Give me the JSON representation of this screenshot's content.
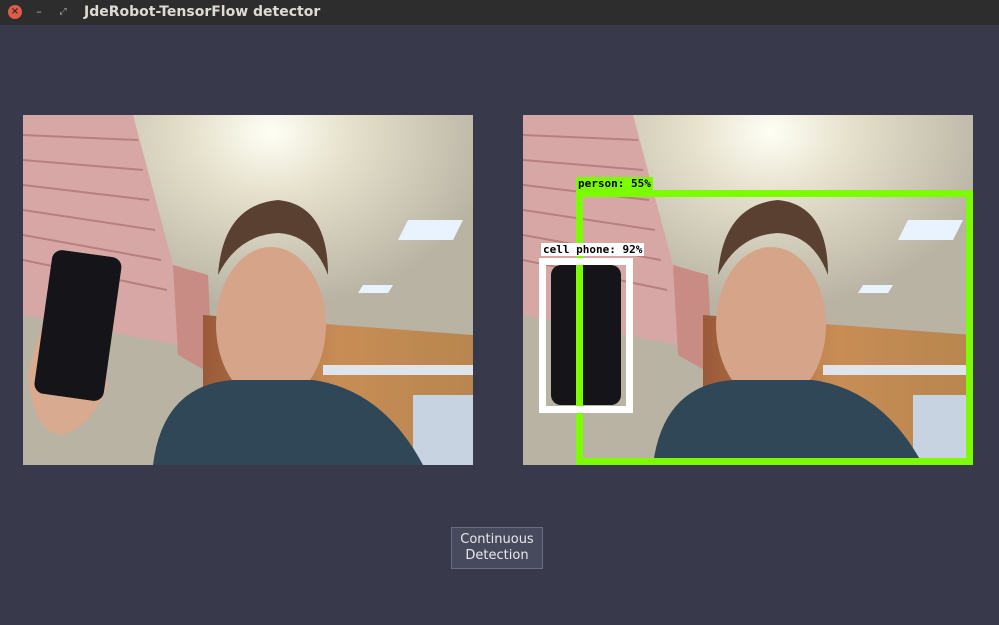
{
  "window": {
    "title": "JdeRobot-TensorFlow detector",
    "controls": {
      "close": "×",
      "minimize": "–",
      "maximize": "⤢"
    }
  },
  "input_view": {
    "description": "live camera feed"
  },
  "output_view": {
    "detections": [
      {
        "label": "person: 55%",
        "color": "#7cfc00"
      },
      {
        "label": "cell phone: 92%",
        "color": "#ffffff"
      }
    ]
  },
  "controls": {
    "detect_button": {
      "line1": "Continuous",
      "line2": "Detection"
    }
  },
  "colors": {
    "background": "#383a4c",
    "titlebar": "#2d2d2d",
    "person_box": "#7cfc00",
    "phone_box": "#ffffff"
  }
}
